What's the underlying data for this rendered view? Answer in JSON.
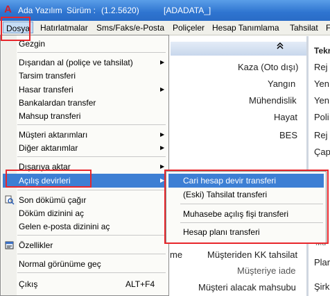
{
  "titlebar": {
    "app_name": "Ada Yazılım",
    "version_label": "Sürüm :",
    "version": "(1.2.5620)",
    "company": "[ADADATA_]"
  },
  "menubar": [
    "Dosya",
    "Hatırlatmalar",
    "Sms/Faks/e-Posta",
    "Poliçeler",
    "Hesap Tanımlama",
    "Tahsilat",
    "F"
  ],
  "background": {
    "left_items": [
      "Kaza (Oto dışı)",
      "Yangın",
      "Mühendislik",
      "Hayat",
      "BES"
    ],
    "right_items": [
      "Tekr",
      "Rej",
      "Yen",
      "Yen",
      "Poli",
      "Rej",
      "Çap",
      "Mü",
      "Plar",
      "Şirk"
    ],
    "bottom_items": [
      "me",
      "Müşteriden KK tahsilat",
      "Müşteriye iade",
      "Müşteri alacak mahsubu"
    ]
  },
  "dosya_menu": {
    "exit": "Gezgin",
    "items": [
      "Dışarıdan al (poliçe ve tahsilat)",
      "Tarsim transferi",
      "Hasar transferi",
      "Bankalardan transfer",
      "Mahsup transferi",
      "Müşteri aktarımları",
      "Diğer aktarımlar",
      "Dışarıya aktar",
      "Açılış devirleri",
      "Son dökümü çağır",
      "Döküm dizinini aç",
      "Gelen e-posta dizinini aç",
      "Özellikler",
      "Normal görünüme geç",
      "Çıkış"
    ],
    "exit_shortcut": "ALT+F4"
  },
  "acilis_submenu": [
    "Cari hesap devir transferi",
    "(Eski) Tahsilat transferi",
    "Muhasebe açılış fişi transferi",
    "Hesap planı transferi"
  ],
  "colors": {
    "highlight": "#3d7fd4",
    "annotation": "#e8262b",
    "titlebar": "#2e74d0"
  }
}
